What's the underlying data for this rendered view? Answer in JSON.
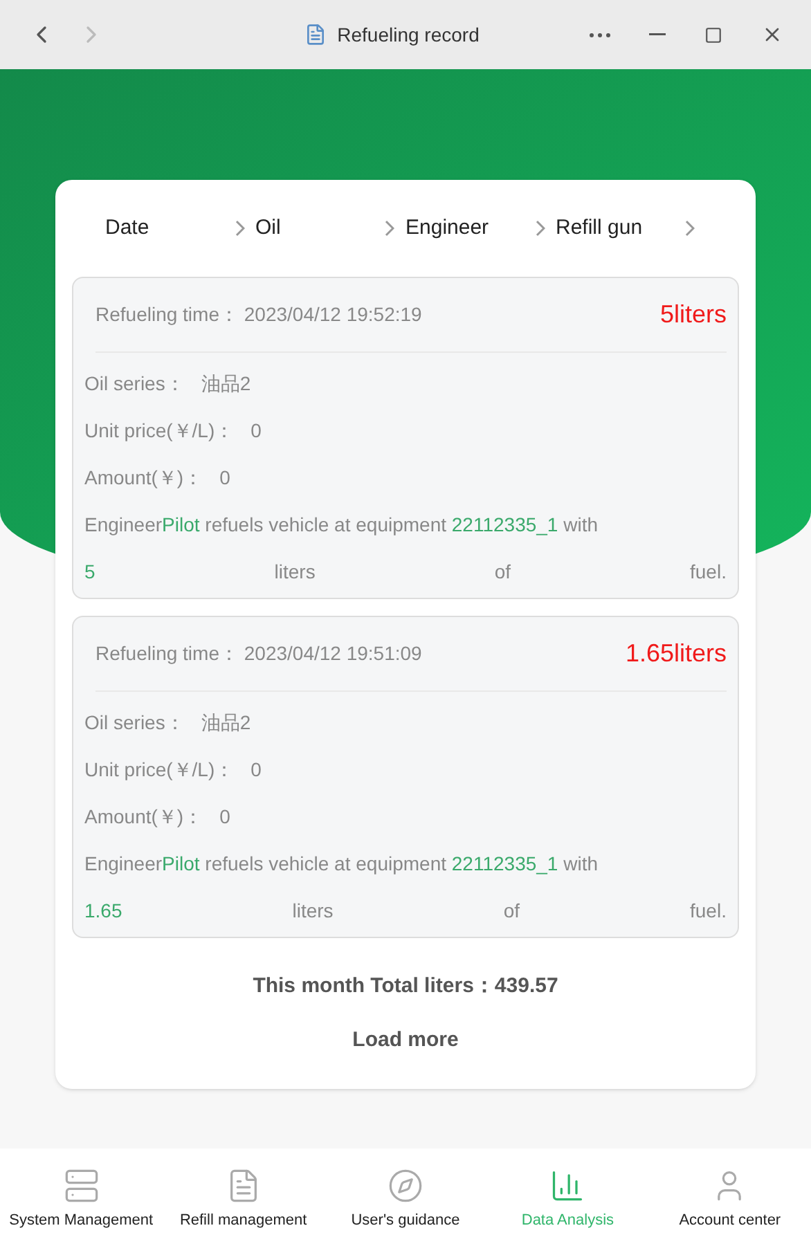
{
  "window": {
    "title": "Refueling record"
  },
  "filters": [
    {
      "label": "Date"
    },
    {
      "label": "Oil"
    },
    {
      "label": "Engineer"
    },
    {
      "label": "Refill gun"
    }
  ],
  "records": [
    {
      "time_label": "Refueling time：",
      "time": "2023/04/12 19:52:19",
      "liters": "5liters",
      "fields": [
        {
          "label": "Oil series：",
          "value": "油品2"
        },
        {
          "label": "Unit price(￥/L)：",
          "value": "0"
        },
        {
          "label": "Amount(￥)：",
          "value": "0"
        }
      ],
      "desc": {
        "prefix": "Engineer",
        "engineer": "Pilot",
        "middle": "refuels vehicle  at equipment",
        "device": "22112335_1",
        "suffix": "with",
        "amount": "5",
        "words": [
          "liters",
          "of",
          "fuel."
        ]
      }
    },
    {
      "time_label": "Refueling time：",
      "time": "2023/04/12 19:51:09",
      "liters": "1.65liters",
      "fields": [
        {
          "label": "Oil series：",
          "value": "油品2"
        },
        {
          "label": "Unit price(￥/L)：",
          "value": "0"
        },
        {
          "label": "Amount(￥)：",
          "value": "0"
        }
      ],
      "desc": {
        "prefix": "Engineer",
        "engineer": "Pilot",
        "middle": "refuels vehicle  at equipment",
        "device": "22112335_1",
        "suffix": "with",
        "amount": "1.65",
        "words": [
          "liters",
          "of",
          "fuel."
        ]
      }
    }
  ],
  "total": "This month Total liters：439.57",
  "load_more": "Load more",
  "nav": [
    {
      "label": "System Management",
      "kind": "system",
      "selected": false
    },
    {
      "label": "Refill management",
      "kind": "refill",
      "selected": false
    },
    {
      "label": "User's guidance",
      "kind": "guide",
      "selected": false
    },
    {
      "label": "Data Analysis",
      "kind": "chart",
      "selected": true
    },
    {
      "label": "Account center",
      "kind": "user",
      "selected": false
    }
  ]
}
